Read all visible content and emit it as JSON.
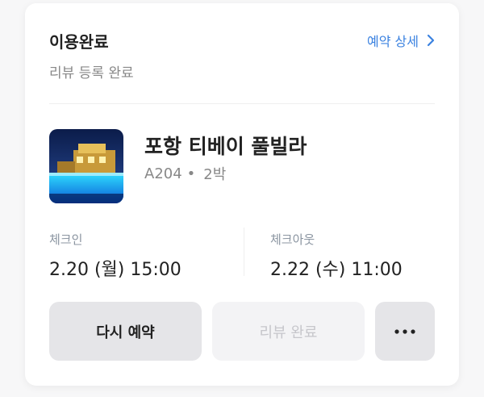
{
  "booking": {
    "status": "이용완료",
    "substatus": "리뷰 등록 완료",
    "detail_link": "예약 상세",
    "hotel_name": "포항 티베이 풀빌라",
    "room": "A204",
    "separator": "•",
    "nights": "2박",
    "checkin": {
      "label": "체크인",
      "value": "2.20 (월) 15:00"
    },
    "checkout": {
      "label": "체크아웃",
      "value": "2.22 (수) 11:00"
    }
  },
  "actions": {
    "rebook_label": "다시 예약",
    "review_label": "리뷰 완료",
    "more_icon": "more-horizontal-icon"
  },
  "colors": {
    "accent": "#3b82e0",
    "primary_text": "#222222",
    "secondary_text": "#888888",
    "button_bg": "#e5e5e8",
    "disabled_bg": "#f3f3f5"
  }
}
